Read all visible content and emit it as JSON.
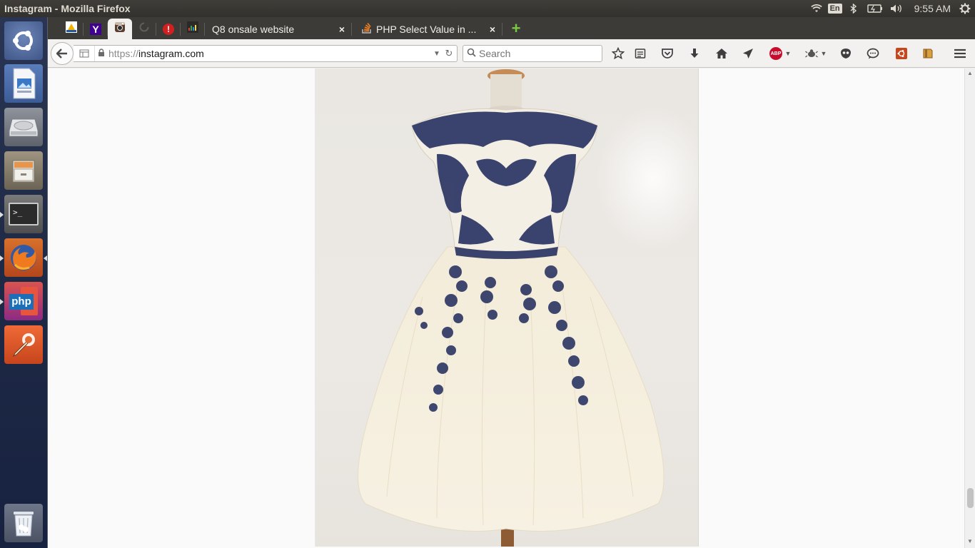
{
  "window": {
    "title": "Instagram - Mozilla Firefox"
  },
  "panel": {
    "keyboard_layout": "En",
    "clock": "9:55 AM"
  },
  "launcher": {
    "items": [
      {
        "name": "ubuntu-dash-icon"
      },
      {
        "name": "libreoffice-impress-icon"
      },
      {
        "name": "disk-drive-icon"
      },
      {
        "name": "file-cabinet-icon"
      },
      {
        "name": "terminal-icon",
        "glyph": ">_"
      },
      {
        "name": "firefox-icon"
      },
      {
        "name": "phpstorm-icon",
        "glyph": "php"
      },
      {
        "name": "inkscape-pen-icon"
      },
      {
        "name": "trash-icon"
      }
    ]
  },
  "tabs": {
    "pinned": [
      {
        "icon": "pinned-site-icon"
      },
      {
        "icon": "yahoo-icon",
        "glyph": "Y"
      },
      {
        "icon": "instagram-icon"
      },
      {
        "icon": "loading-icon"
      },
      {
        "icon": "alert-icon"
      },
      {
        "icon": "analytics-icon"
      }
    ],
    "open": [
      {
        "label": "Q8 onsale website",
        "close": "×"
      },
      {
        "label": "PHP Select Value in ...",
        "close": "×"
      }
    ],
    "new_tab": "+"
  },
  "navbar": {
    "url_scheme": "https://",
    "url_host": "instagram.com",
    "search_placeholder": "Search",
    "abp_label": "ABP"
  },
  "content": {
    "image_subject": "dress-photo",
    "accent": "#2b3563"
  }
}
